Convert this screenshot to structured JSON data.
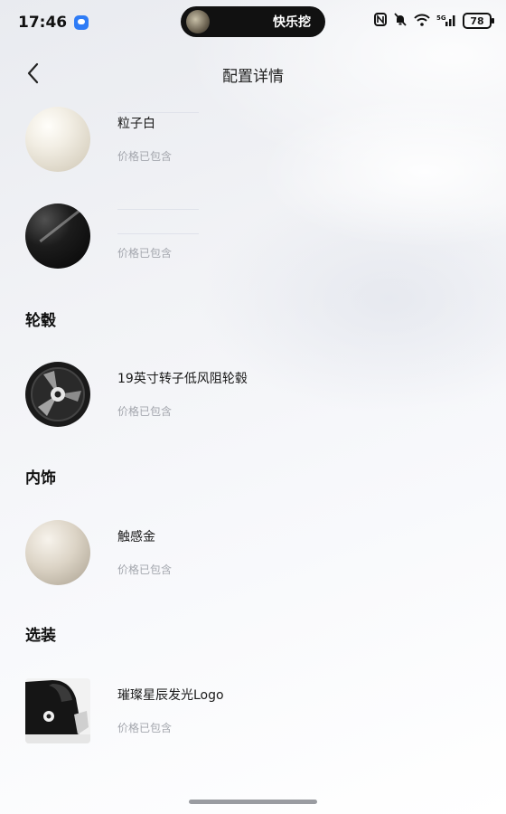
{
  "status_bar": {
    "time": "17:46",
    "island_text": "快乐挖",
    "battery": "78",
    "signal": "5G"
  },
  "nav": {
    "title": "配置详情"
  },
  "colors": {
    "price_text": "#a3a6ad",
    "section_title": "#111111"
  },
  "paint": [
    {
      "name": "粒子白",
      "price": "价格已包含"
    },
    {
      "name": "",
      "price": "价格已包含"
    }
  ],
  "sections": {
    "wheels": "轮毂",
    "interior": "内饰",
    "options": "选装"
  },
  "wheels": {
    "name": "19英寸转子低风阻轮毂",
    "price": "价格已包含"
  },
  "interior": {
    "name": "触感金",
    "price": "价格已包含"
  },
  "options": {
    "name": "璀璨星辰发光Logo",
    "price": "价格已包含"
  }
}
